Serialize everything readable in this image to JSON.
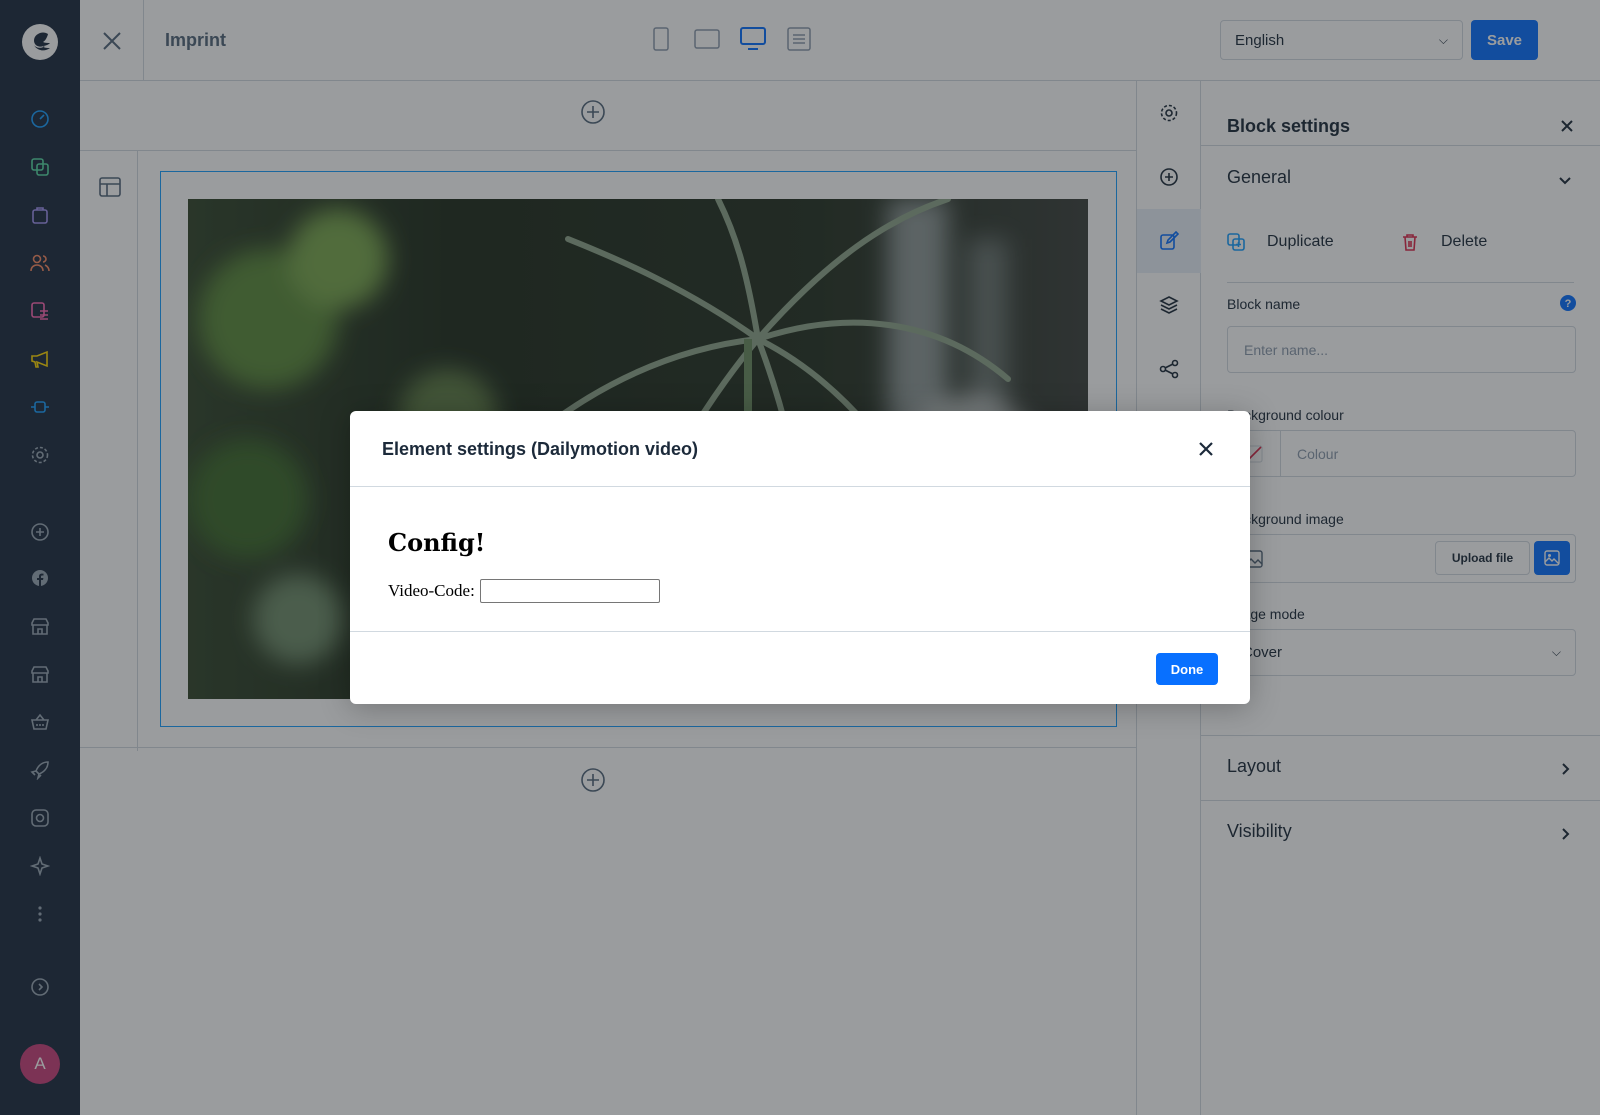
{
  "app": {
    "nav_icons": [
      "dashboard-icon",
      "catalogues-icon",
      "orders-icon",
      "customers-icon",
      "content-icon",
      "marketing-icon",
      "extensions-icon",
      "settings-icon",
      "add-sales-channel-icon",
      "facebook-icon",
      "storefront-icon",
      "headless-icon",
      "shop-basket-icon",
      "rocket-icon",
      "instagram-icon",
      "sparkle-icon",
      "more-icon",
      "expand-icon"
    ],
    "avatar_initial": "A",
    "accent_color": "#0870ff"
  },
  "topbar": {
    "title": "Imprint",
    "language": "English",
    "save_label": "Save",
    "device_views": [
      "mobile-view-icon",
      "tablet-view-icon",
      "desktop-view-icon",
      "form-view-icon"
    ]
  },
  "panel": {
    "title": "Block settings",
    "general_label": "General",
    "duplicate_label": "Duplicate",
    "delete_label": "Delete",
    "block_name_label": "Block name",
    "block_name_placeholder": "Enter name...",
    "bg_colour_label": "Background colour",
    "colour_placeholder": "Colour",
    "bg_image_label": "Background image",
    "upload_label": "Upload file",
    "display_mode_label": "Image mode",
    "display_mode_value": "Cover",
    "layout_label": "Layout",
    "visibility_label": "Visibility"
  },
  "modal": {
    "title": "Element settings (Dailymotion video)",
    "heading": "Config!",
    "video_code_label": "Video-Code:",
    "video_code_value": "",
    "done_label": "Done"
  }
}
